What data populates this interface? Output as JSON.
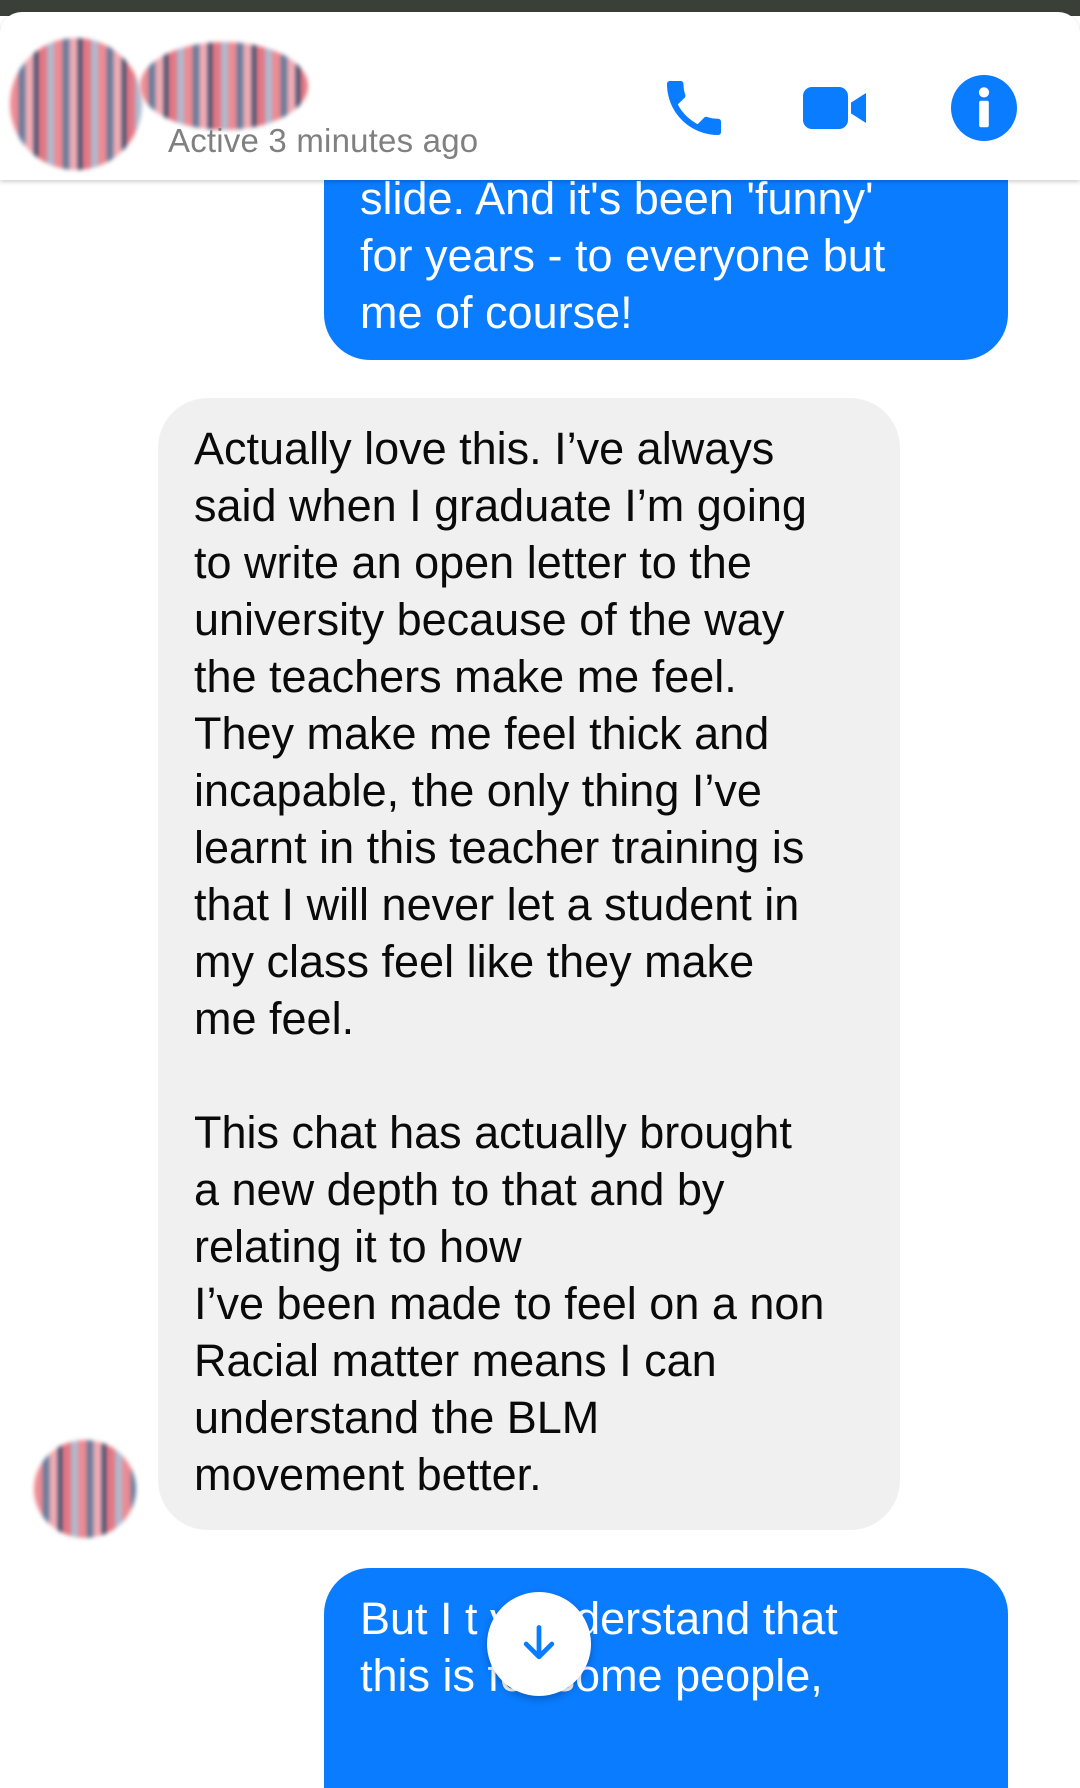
{
  "header": {
    "status": "Active 3 minutes ago",
    "icons": [
      "phone-icon",
      "video-camera-icon",
      "info-icon"
    ],
    "accent_color": "#0a7cff"
  },
  "messages": [
    {
      "direction": "sent",
      "text": "slide. And it's been 'funny'\nfor years - to everyone but\nme of course!"
    },
    {
      "direction": "received",
      "text": "Actually love this. I’ve always\nsaid when I graduate I’m going\nto write an open letter to the\nuniversity because of the way\nthe teachers make me feel.\nThey make me feel thick and\nincapable, the only thing I’ve\nlearnt in this teacher training is\nthat I will never let a student in\nmy class feel like they make\nme feel.\n\nThis chat has actually brought\na new depth to that and by\nrelating it to how\nI’ve been made to feel on a non\nRacial matter means I can\nunderstand the BLM\nmovement better."
    },
    {
      "direction": "sent",
      "text": "But I t        y understand that\nthis is         for some people,"
    }
  ],
  "colors": {
    "sent_bubble": "#0a7cff",
    "received_bubble": "#f0f0f0"
  }
}
